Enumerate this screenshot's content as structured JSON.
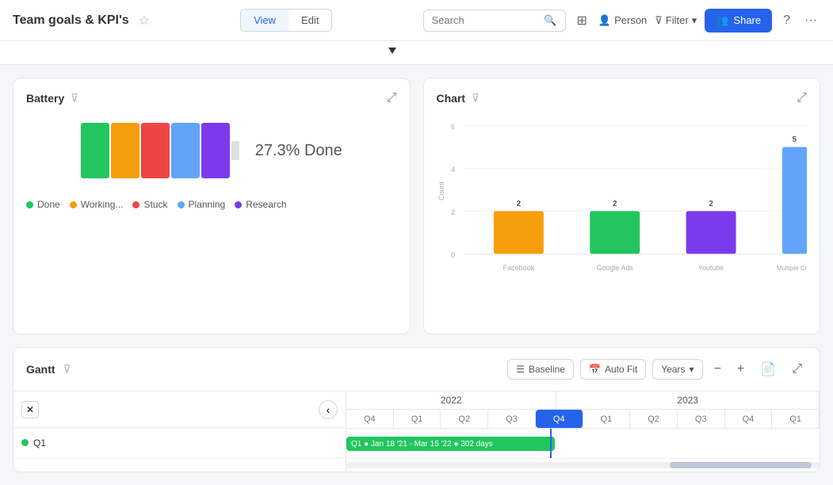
{
  "header": {
    "title": "Team goals & KPI's",
    "view_label": "View",
    "edit_label": "Edit",
    "share_label": "Share",
    "search_placeholder": "Search",
    "person_label": "Person",
    "filter_label": "Filter"
  },
  "battery_card": {
    "title": "Battery",
    "percent_text": "27.3% Done",
    "legend": [
      {
        "label": "Done",
        "color": "#22c55e"
      },
      {
        "label": "Working...",
        "color": "#f59e0b"
      },
      {
        "label": "Stuck",
        "color": "#ef4444"
      },
      {
        "label": "Planning",
        "color": "#60a5fa"
      },
      {
        "label": "Research",
        "color": "#7c3aed"
      }
    ],
    "bars": [
      {
        "color": "#22c55e"
      },
      {
        "color": "#f59e0b"
      },
      {
        "color": "#ef4444"
      },
      {
        "color": "#60a5fa"
      },
      {
        "color": "#7c3aed"
      }
    ]
  },
  "chart_card": {
    "title": "Chart",
    "y_axis_label": "Count",
    "bars": [
      {
        "label": "Facebook",
        "value": 2,
        "color": "#f59e0b"
      },
      {
        "label": "Google Ads",
        "value": 2,
        "color": "#22c55e"
      },
      {
        "label": "Youtube",
        "value": 2,
        "color": "#7c3aed"
      },
      {
        "label": "Multiple Cha...",
        "value": 5,
        "color": "#60a5fa"
      }
    ],
    "y_ticks": [
      0,
      2,
      4,
      6
    ]
  },
  "gantt_card": {
    "title": "Gantt",
    "baseline_label": "Baseline",
    "autofit_label": "Auto Fit",
    "years_label": "Years",
    "years_2022": "2022",
    "years_2023": "2023",
    "quarters": [
      "Q4",
      "Q1",
      "Q2",
      "Q3",
      "Q4",
      "Q1",
      "Q2",
      "Q3",
      "Q4",
      "Q1"
    ],
    "highlight_quarter": "Q4",
    "row": {
      "label": "Q1",
      "dot_color": "#22c55e",
      "bar_text": "Q1 ● Jan 18 '21 - Mar 15 '22 ● 302 days"
    }
  }
}
